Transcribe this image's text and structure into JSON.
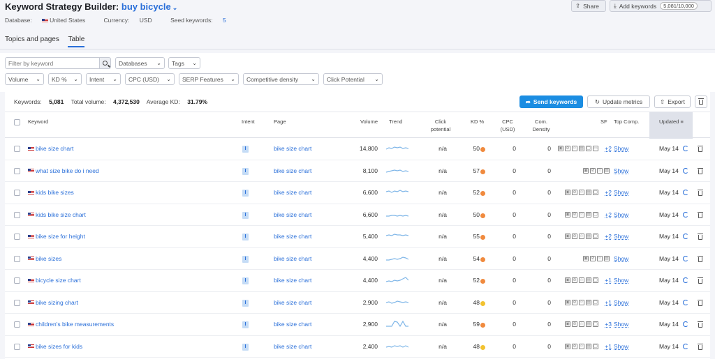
{
  "header": {
    "title_prefix": "Keyword Strategy Builder:",
    "title_keyword": "buy bicycle",
    "database_label": "Database:",
    "database_value": "United States",
    "currency_label": "Currency:",
    "currency_value": "USD",
    "seed_label": "Seed keywords:",
    "seed_value": "5",
    "share_label": "Share",
    "add_keywords_label": "Add keywords",
    "quota": "5,081/10,000"
  },
  "tabs": [
    {
      "label": "Topics and pages",
      "active": false
    },
    {
      "label": "Table",
      "active": true
    }
  ],
  "filters": {
    "search_placeholder": "Filter by keyword",
    "row1": [
      "Databases",
      "Tags"
    ],
    "row2": [
      "Volume",
      "KD %",
      "Intent",
      "CPC (USD)",
      "SERP Features",
      "Competitive density",
      "Click Potential"
    ]
  },
  "summary": {
    "keywords_label": "Keywords:",
    "keywords_value": "5,081",
    "volume_label": "Total volume:",
    "volume_value": "4,372,530",
    "kd_label": "Average KD:",
    "kd_value": "31.79%",
    "send_label": "Send keywords",
    "update_label": "Update metrics",
    "export_label": "Export"
  },
  "columns": {
    "keyword": "Keyword",
    "intent": "Intent",
    "page": "Page",
    "volume": "Volume",
    "trend": "Trend",
    "click1": "Click",
    "click2": "potential",
    "kd": "KD %",
    "cpc1": "CPC",
    "cpc2": "(USD)",
    "com1": "Com.",
    "com2": "Density",
    "sf": "SF",
    "topcomp": "Top Comp.",
    "updated": "Updated"
  },
  "colors": {
    "kd_orange": "#f08a3e",
    "kd_yellow": "#f2c230",
    "accent": "#2a6fd9",
    "send_button": "#1b8de2"
  },
  "rows": [
    {
      "keyword": "bike size chart",
      "intent": "I",
      "page": "bike size chart",
      "volume": "14,800",
      "click": "n/a",
      "kd": "50",
      "kd_color": "orange",
      "cpc": "0",
      "density": "0",
      "sf_more": "+2",
      "top": "Show",
      "updated": "May 14",
      "sf_icons": 6
    },
    {
      "keyword": "what size bike do i need",
      "intent": "I",
      "page": "bike size chart",
      "volume": "8,100",
      "click": "n/a",
      "kd": "57",
      "kd_color": "orange",
      "cpc": "0",
      "density": "0",
      "sf_more": "",
      "top": "Show",
      "updated": "May 14",
      "sf_icons": 4
    },
    {
      "keyword": "kids bike sizes",
      "intent": "I",
      "page": "bike size chart",
      "volume": "6,600",
      "click": "n/a",
      "kd": "52",
      "kd_color": "orange",
      "cpc": "0",
      "density": "0",
      "sf_more": "+2",
      "top": "Show",
      "updated": "May 14",
      "sf_icons": 5
    },
    {
      "keyword": "kids bike size chart",
      "intent": "I",
      "page": "bike size chart",
      "volume": "6,600",
      "click": "n/a",
      "kd": "50",
      "kd_color": "orange",
      "cpc": "0",
      "density": "0",
      "sf_more": "+2",
      "top": "Show",
      "updated": "May 14",
      "sf_icons": 5
    },
    {
      "keyword": "bike size for height",
      "intent": "I",
      "page": "bike size chart",
      "volume": "5,400",
      "click": "n/a",
      "kd": "55",
      "kd_color": "orange",
      "cpc": "0",
      "density": "0",
      "sf_more": "+2",
      "top": "Show",
      "updated": "May 14",
      "sf_icons": 5
    },
    {
      "keyword": "bike sizes",
      "intent": "I",
      "page": "bike size chart",
      "volume": "4,400",
      "click": "n/a",
      "kd": "54",
      "kd_color": "orange",
      "cpc": "0",
      "density": "0",
      "sf_more": "",
      "top": "Show",
      "updated": "May 14",
      "sf_icons": 4
    },
    {
      "keyword": "bicycle size chart",
      "intent": "I",
      "page": "bike size chart",
      "volume": "4,400",
      "click": "n/a",
      "kd": "52",
      "kd_color": "orange",
      "cpc": "0",
      "density": "0",
      "sf_more": "+1",
      "top": "Show",
      "updated": "May 14",
      "sf_icons": 5
    },
    {
      "keyword": "bike sizing chart",
      "intent": "I",
      "page": "bike size chart",
      "volume": "2,900",
      "click": "n/a",
      "kd": "48",
      "kd_color": "yellow",
      "cpc": "0",
      "density": "0",
      "sf_more": "+1",
      "top": "Show",
      "updated": "May 14",
      "sf_icons": 5
    },
    {
      "keyword": "children's bike measurements",
      "intent": "I",
      "page": "bike size chart",
      "volume": "2,900",
      "click": "n/a",
      "kd": "59",
      "kd_color": "orange",
      "cpc": "0",
      "density": "0",
      "sf_more": "+3",
      "top": "Show",
      "updated": "May 14",
      "sf_icons": 5
    },
    {
      "keyword": "bike sizes for kids",
      "intent": "I",
      "page": "bike size chart",
      "volume": "2,400",
      "click": "n/a",
      "kd": "48",
      "kd_color": "yellow",
      "cpc": "0",
      "density": "0",
      "sf_more": "+1",
      "top": "Show",
      "updated": "May 14",
      "sf_icons": 5
    }
  ]
}
